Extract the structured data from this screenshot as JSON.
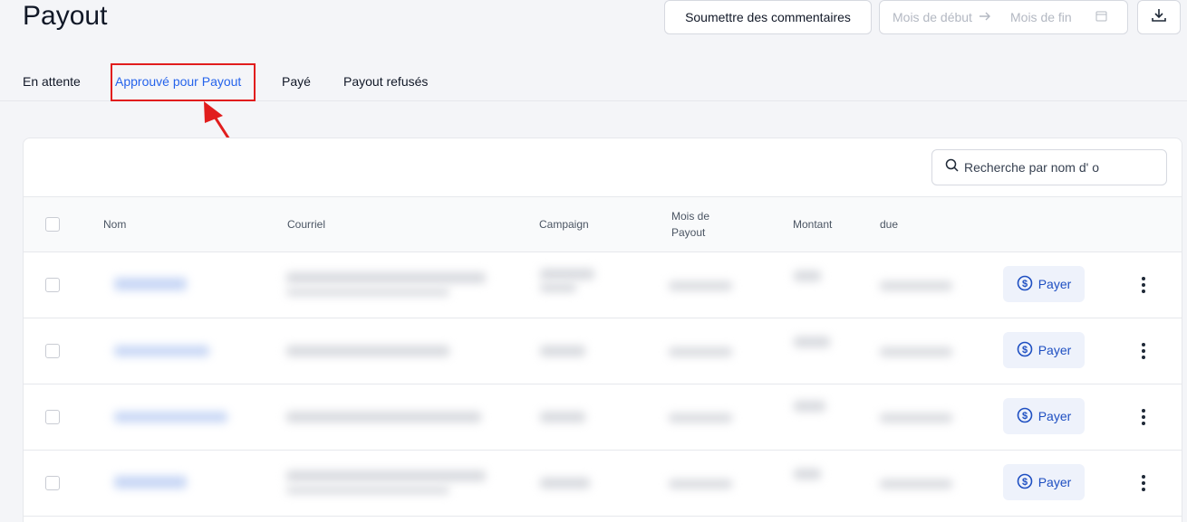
{
  "page": {
    "title": "Payout"
  },
  "toolbar": {
    "feedback_label": "Soumettre des commentaires",
    "date_start_placeholder": "Mois de début",
    "date_end_placeholder": "Mois de fin",
    "download_icon": "download-icon",
    "calendar_icon": "calendar-icon"
  },
  "tabs": [
    {
      "label": "En attente",
      "active": false
    },
    {
      "label": "Approuvé pour Payout",
      "active": true
    },
    {
      "label": "Payé",
      "active": false
    },
    {
      "label": "Payout refusés",
      "active": false
    }
  ],
  "search": {
    "placeholder": "Recherche par nom d' o",
    "icon": "search-icon"
  },
  "table": {
    "columns": {
      "name": "Nom",
      "email": "Courriel",
      "campaign": "Campaign",
      "month_line1": "Mois de",
      "month_line2": "Payout",
      "amount": "Montant",
      "due": "due"
    },
    "rows": [
      {
        "action": "Payer"
      },
      {
        "action": "Payer"
      },
      {
        "action": "Payer"
      },
      {
        "action": "Payer"
      }
    ]
  },
  "colors": {
    "accent": "#2563eb",
    "highlight": "#e11d1d",
    "pay_button_bg": "#eef2fb"
  }
}
